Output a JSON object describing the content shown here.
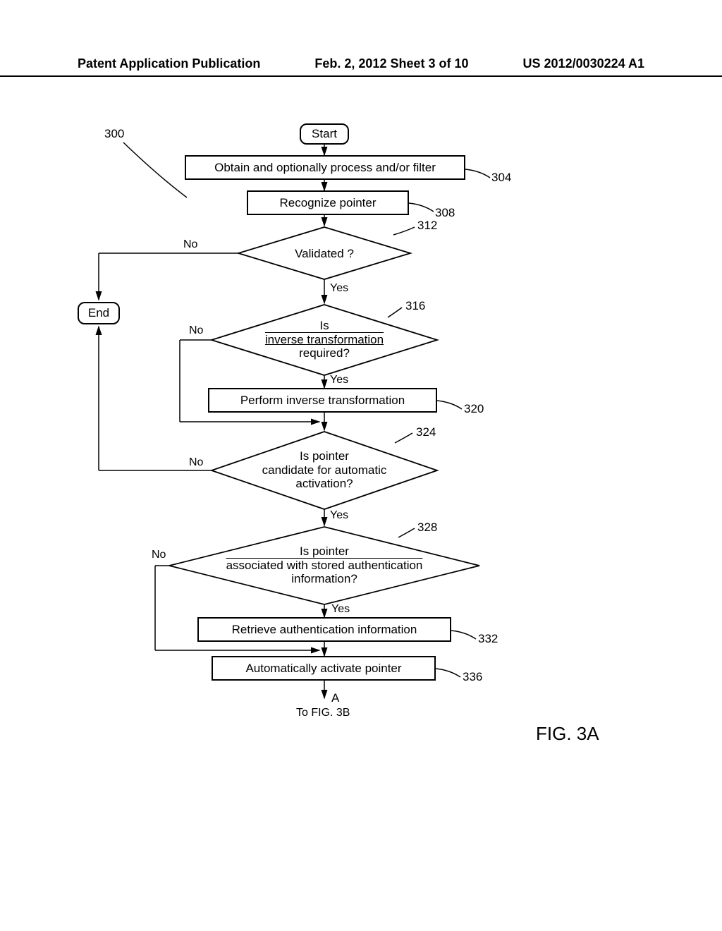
{
  "header": {
    "left": "Patent Application Publication",
    "center": "Feb. 2, 2012  Sheet 3 of 10",
    "right": "US 2012/0030224 A1"
  },
  "flow": {
    "ref_main": "300",
    "start": "Start",
    "end": "End",
    "step304": "Obtain and optionally process and/or filter",
    "step308": "Recognize pointer",
    "step312": "Validated ?",
    "step316_l1": "Is",
    "step316_l2": " inverse transformation ",
    "step316_l3": "required?",
    "step320": "Perform inverse transformation",
    "step324_l1": "Is pointer",
    "step324_l2": "candidate for automatic",
    "step324_l3": "activation?",
    "step328_l1": "Is pointer",
    "step328_l2": "associated with stored authentication",
    "step328_l3": "information?",
    "step332": "Retrieve authentication information",
    "step336": "Automatically activate pointer",
    "ref304": "304",
    "ref308": "308",
    "ref312": "312",
    "ref316": "316",
    "ref320": "320",
    "ref324": "324",
    "ref328": "328",
    "ref332": "332",
    "ref336": "336",
    "yes": "Yes",
    "no": "No",
    "connector": "A",
    "tofig": "To FIG. 3B",
    "figlabel": "FIG. 3A"
  }
}
